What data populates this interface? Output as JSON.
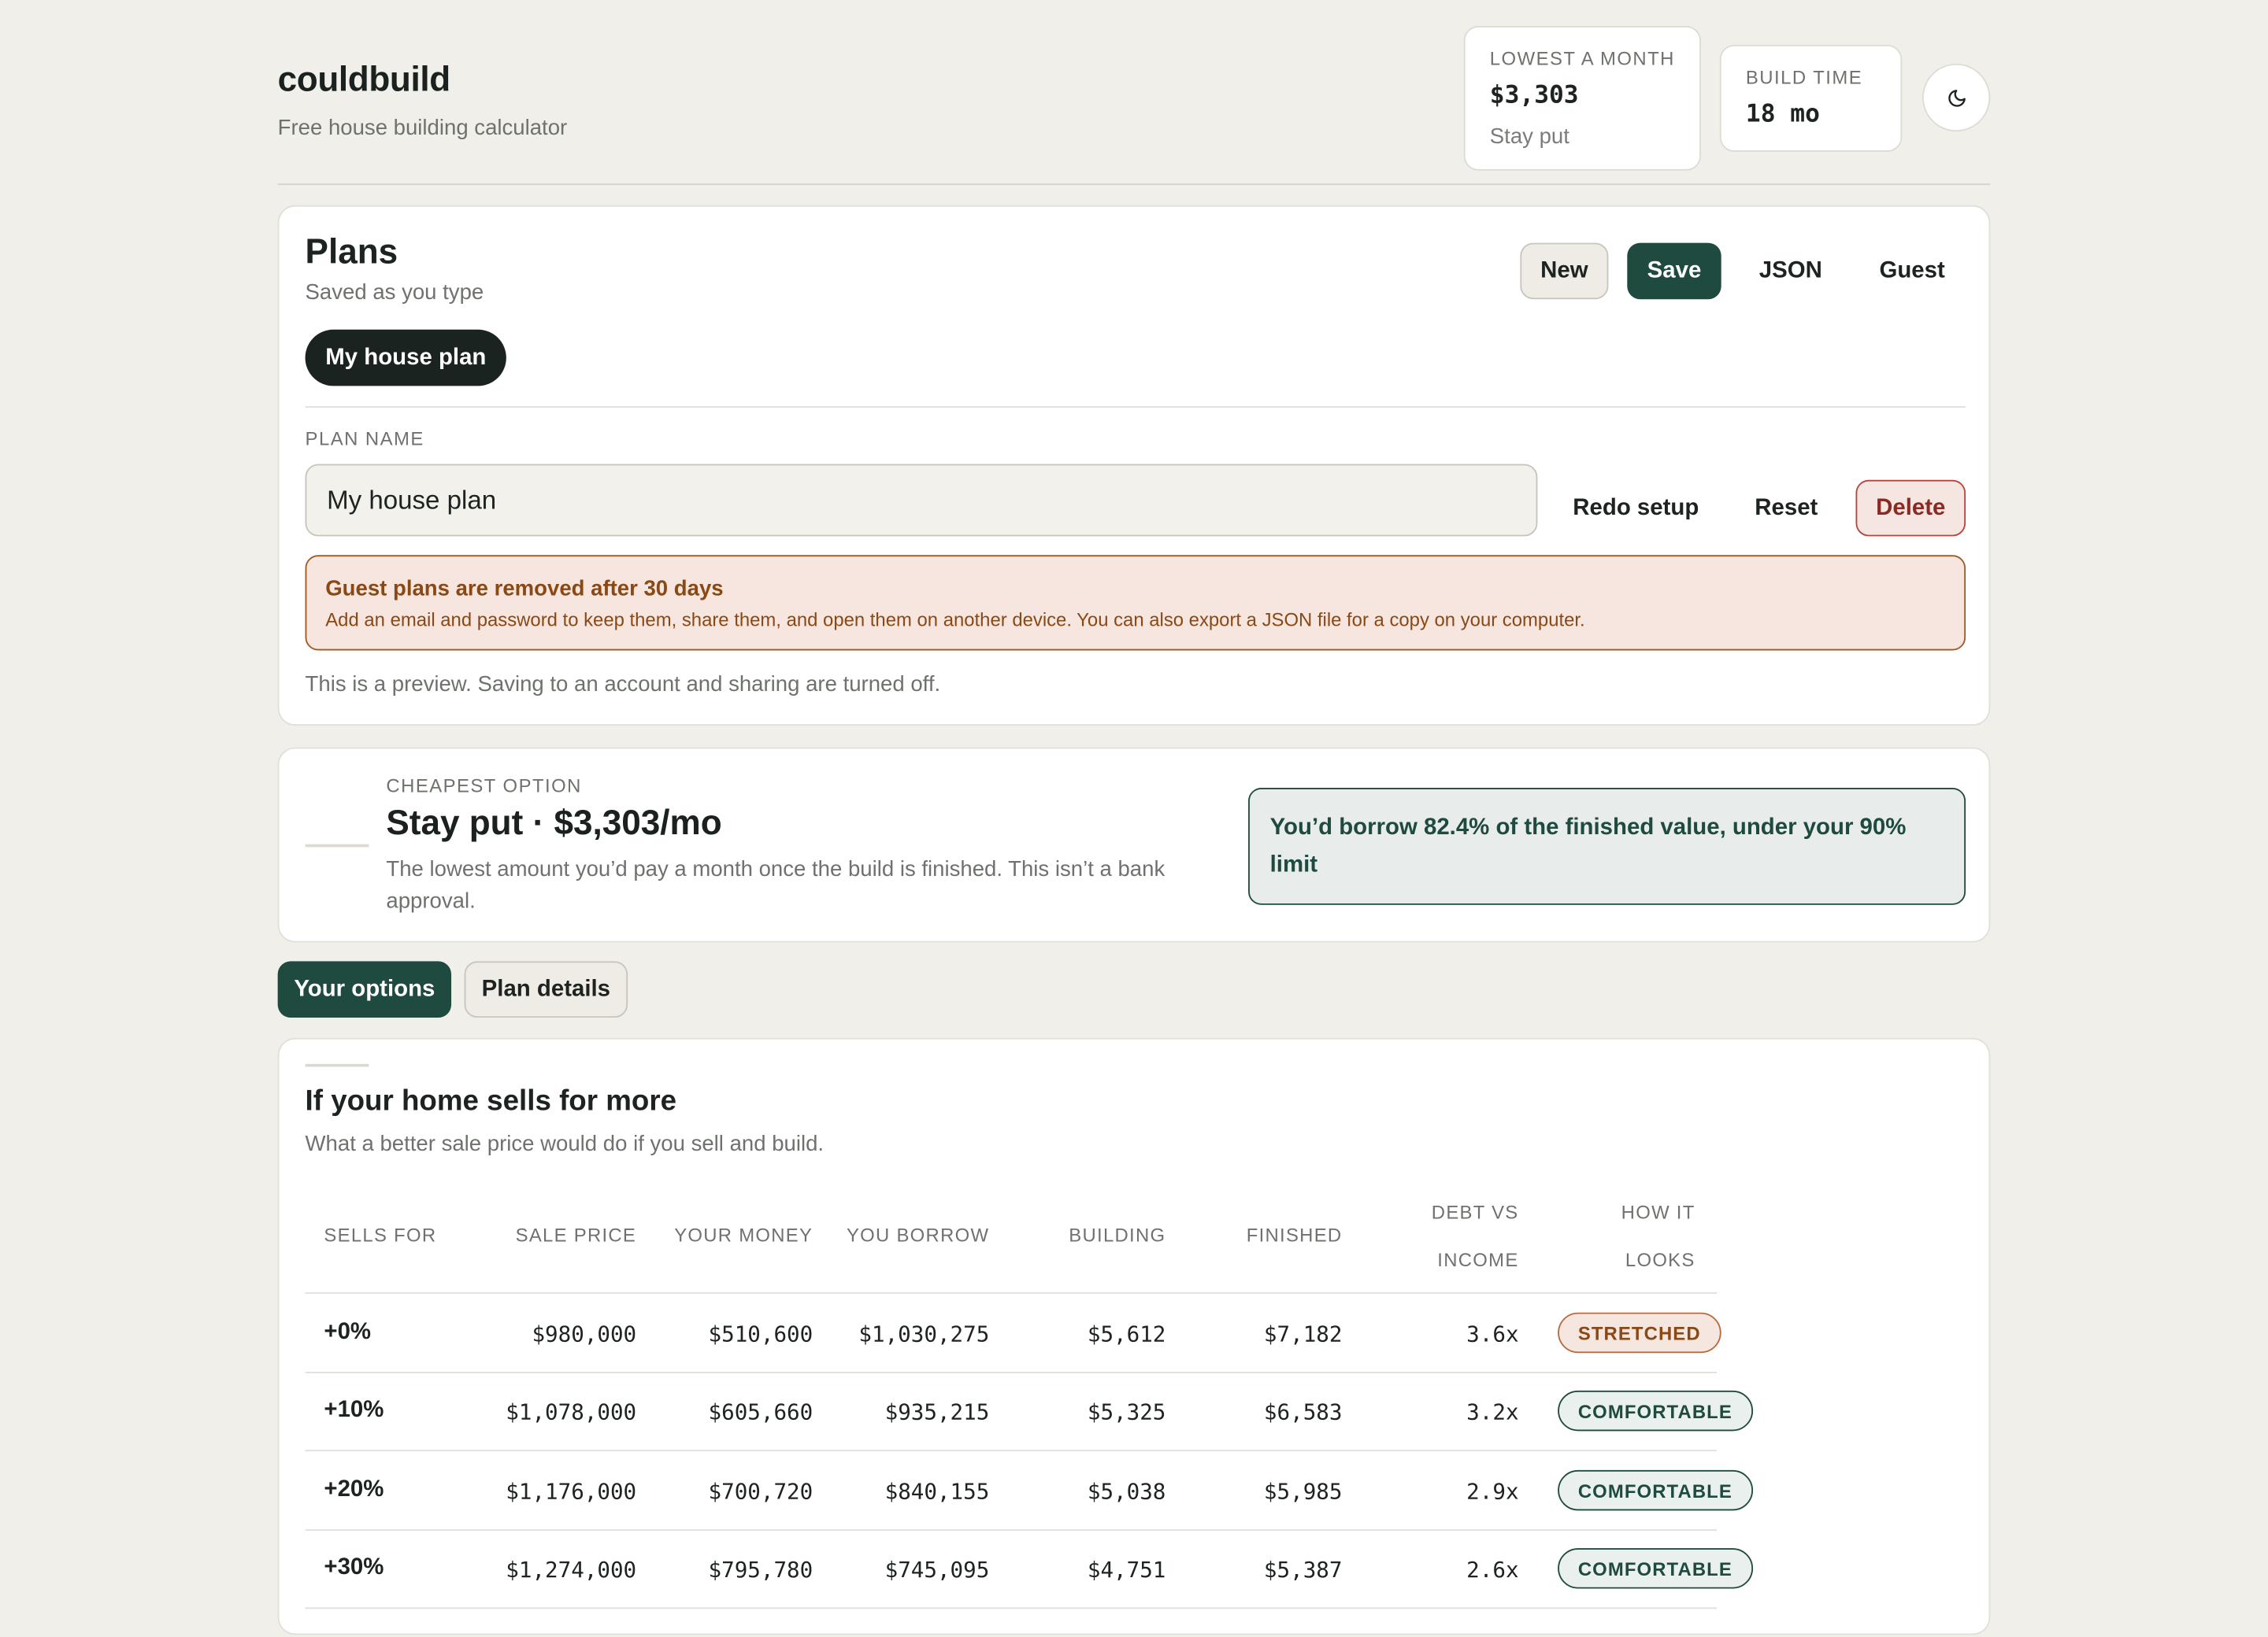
{
  "app": {
    "name": "couldbuild",
    "tagline": "Free house building calculator"
  },
  "stats": {
    "lowest": {
      "label": "LOWEST A MONTH",
      "value": "$3,303",
      "sub": "Stay put"
    },
    "build_time": {
      "label": "BUILD TIME",
      "value": "18 mo"
    },
    "theme_icon": "moon-icon"
  },
  "plans": {
    "title": "Plans",
    "subtitle": "Saved as you type",
    "buttons": {
      "new": "New",
      "save": "Save",
      "json": "JSON",
      "guest": "Guest"
    },
    "active_plan": "My house plan",
    "name_label": "PLAN NAME",
    "name_value": "My house plan",
    "actions": {
      "redo": "Redo setup",
      "reset": "Reset",
      "delete": "Delete"
    },
    "notice": {
      "title": "Guest plans are removed after 30 days",
      "body": "Add an email and password to keep them, share them, and open them on another device. You can also export a JSON file for a copy on your computer."
    },
    "preview_note": "This is a preview. Saving to an account and sharing are turned off."
  },
  "cheapest": {
    "label": "CHEAPEST OPTION",
    "title": "Stay put · $3,303/mo",
    "description": "The lowest amount you’d pay a month once the build is finished. This isn’t a bank approval.",
    "borrow_note": "You’d borrow 82.4% of the finished value, under your 90% limit"
  },
  "tabs": {
    "options": "Your options",
    "details": "Plan details"
  },
  "table": {
    "title": "If your home sells for more",
    "subtitle": "What a better sale price would do if you sell and build.",
    "headers": {
      "sells_for": "SELLS FOR",
      "sale_price": "SALE PRICE",
      "your_money": "YOUR MONEY",
      "you_borrow": "YOU BORROW",
      "building": "BUILDING",
      "finished": "FINISHED",
      "debt_1": "DEBT VS",
      "debt_2": "INCOME",
      "how_1": "HOW IT",
      "how_2": "LOOKS"
    },
    "rows": [
      {
        "sells_for": "+0%",
        "sale_price": "$980,000",
        "your_money": "$510,600",
        "you_borrow": "$1,030,275",
        "building": "$5,612",
        "finished": "$7,182",
        "debt": "3.6x",
        "status": "STRETCHED"
      },
      {
        "sells_for": "+10%",
        "sale_price": "$1,078,000",
        "your_money": "$605,660",
        "you_borrow": "$935,215",
        "building": "$5,325",
        "finished": "$6,583",
        "debt": "3.2x",
        "status": "COMFORTABLE"
      },
      {
        "sells_for": "+20%",
        "sale_price": "$1,176,000",
        "your_money": "$700,720",
        "you_borrow": "$840,155",
        "building": "$5,038",
        "finished": "$5,985",
        "debt": "2.9x",
        "status": "COMFORTABLE"
      },
      {
        "sells_for": "+30%",
        "sale_price": "$1,274,000",
        "your_money": "$795,780",
        "you_borrow": "$745,095",
        "building": "$4,751",
        "finished": "$5,387",
        "debt": "2.6x",
        "status": "COMFORTABLE"
      }
    ]
  }
}
